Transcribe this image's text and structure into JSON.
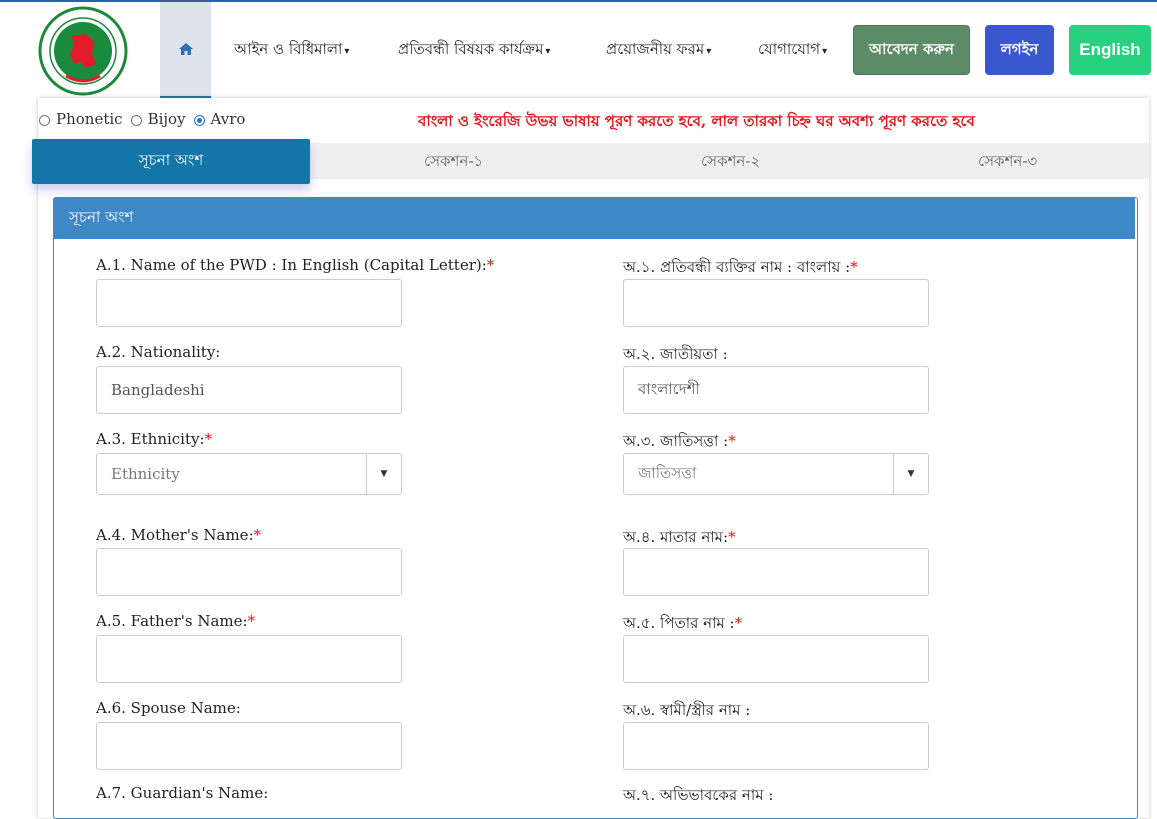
{
  "nav": {
    "items": [
      {
        "label": "আইন ও বিধিমালা",
        "caret": "▾"
      },
      {
        "label": "প্রতিবন্ধী বিষয়ক কার্যক্রম",
        "caret": "▾"
      },
      {
        "label": "প্রয়োজনীয় ফরম",
        "caret": "▾"
      },
      {
        "label": "যোগাযোগ",
        "caret": "▾"
      }
    ],
    "apply_label": "আবেদন করুন",
    "login_label": "লগইন",
    "english_label": "English"
  },
  "keyboard": {
    "options": [
      "Phonetic",
      "Bijoy",
      "Avro"
    ],
    "selected": "Avro"
  },
  "notice": "বাংলা ও ইংরেজি উভয় ভাষায় পূরণ করতে হবে, লাল তারকা চিহ্ন ঘর অবশ্য পূরণ করতে হবে",
  "tabs": [
    "সূচনা অংশ",
    "সেকশন-১",
    "সেকশন-২",
    "সেকশন-৩"
  ],
  "card_title": "সূচনা অংশ",
  "required_mark": "*",
  "fields": {
    "a1_label": "A.1. Name of the PWD : In English (Capital Letter):",
    "b1_label": "অ.১. প্রতিবন্ধী ব্যক্তির নাম : বাংলায় :",
    "a2_label": "A.2. Nationality:",
    "a2_value": "Bangladeshi",
    "b2_label": "অ.২. জাতীয়তা :",
    "b2_value": "বাংলাদেশী",
    "a3_label": "A.3. Ethnicity:",
    "a3_placeholder": "Ethnicity",
    "b3_label": "অ.৩. জাতিসত্তা :",
    "b3_placeholder": "জাতিসত্তা",
    "a4_label": "A.4. Mother's Name:",
    "b4_label": "অ.৪. মাতার নাম:",
    "a5_label": "A.5. Father's Name:",
    "b5_label": "অ.৫. পিতার নাম :",
    "a6_label": "A.6. Spouse Name:",
    "b6_label": "অ.৬. স্বামী/স্ত্রীর নাম :",
    "a7_label": "A.7. Guardian's Name:",
    "b7_label": "অ.৭. অভিভাবকের নাম :"
  },
  "icons": {
    "home": "home-icon",
    "logo": "government-seal",
    "dropdown": "▼"
  },
  "colors": {
    "tab_active": "#1475a9",
    "card_header": "#3f88c8",
    "required": "#e8121b",
    "login": "#3a57cf",
    "english": "#26d27f",
    "apply": "#5c8c67"
  }
}
